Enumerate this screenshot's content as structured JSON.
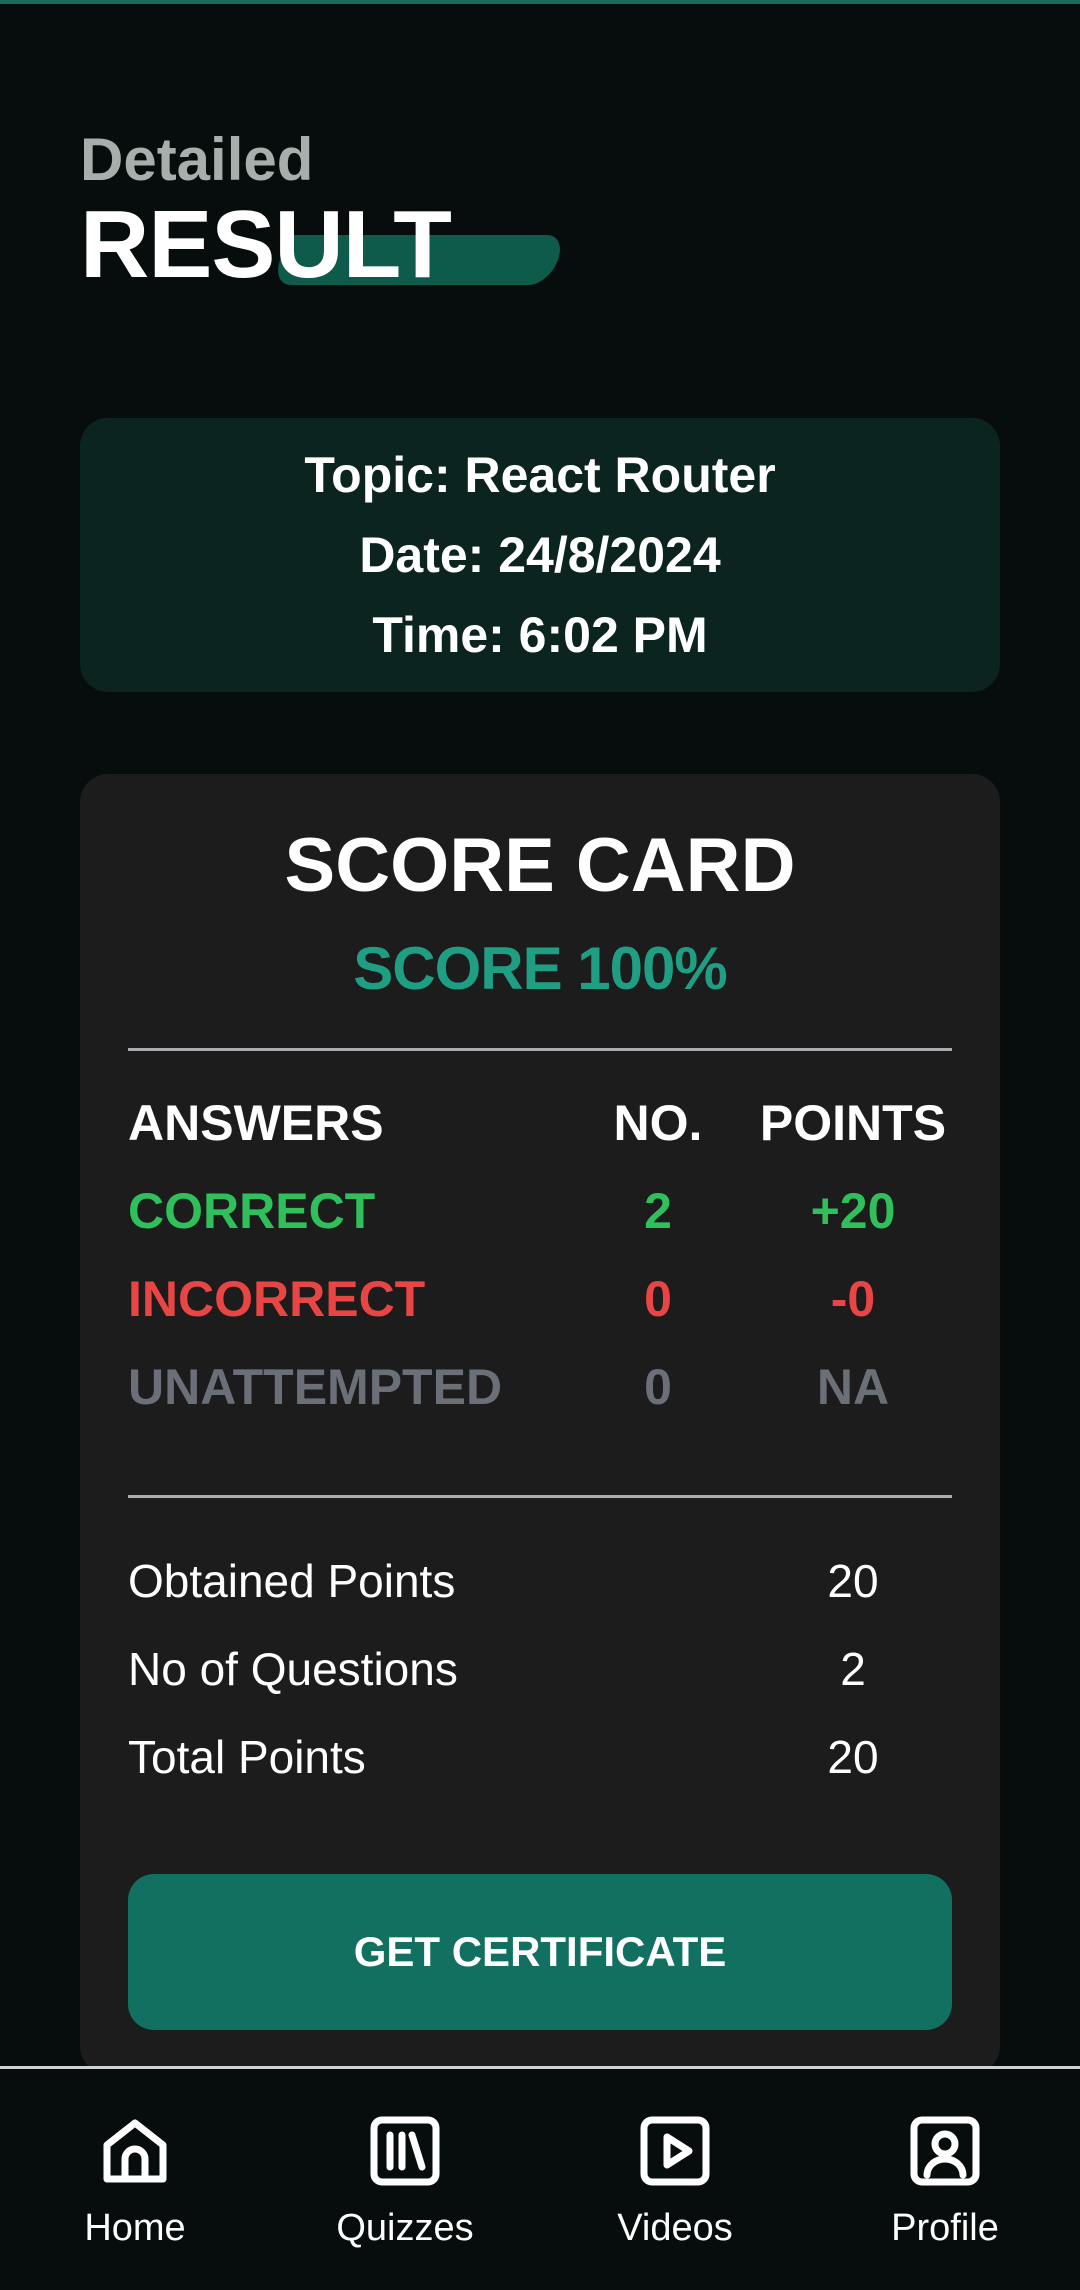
{
  "header": {
    "eyebrow": "Detailed",
    "title": "RESULT"
  },
  "info": {
    "topic": "Topic: React Router",
    "date": "Date: 24/8/2024",
    "time": "Time: 6:02 PM"
  },
  "score_card": {
    "title": "SCORE CARD",
    "score": "SCORE 100%",
    "columns": {
      "answers": "ANSWERS",
      "no": "NO.",
      "points": "POINTS"
    },
    "rows": [
      {
        "label": "CORRECT",
        "no": "2",
        "points": "+20"
      },
      {
        "label": "INCORRECT",
        "no": "0",
        "points": "-0"
      },
      {
        "label": "UNATTEMPTED",
        "no": "0",
        "points": "NA"
      }
    ],
    "summary": [
      {
        "label": "Obtained Points",
        "value": "20"
      },
      {
        "label": "No of Questions",
        "value": "2"
      },
      {
        "label": "Total Points",
        "value": "20"
      }
    ],
    "certificate_label": "GET CERTIFICATE"
  },
  "nav": {
    "items": [
      {
        "label": "Home",
        "icon": "home-icon"
      },
      {
        "label": "Quizzes",
        "icon": "library-icon"
      },
      {
        "label": "Videos",
        "icon": "play-icon"
      },
      {
        "label": "Profile",
        "icon": "user-badge-icon"
      }
    ]
  },
  "colors": {
    "background": "#070d0c",
    "accent": "#1f9e84",
    "button": "#127060",
    "correct": "#2fbf5b",
    "incorrect": "#e84545",
    "unattempted": "#6b6f78"
  }
}
